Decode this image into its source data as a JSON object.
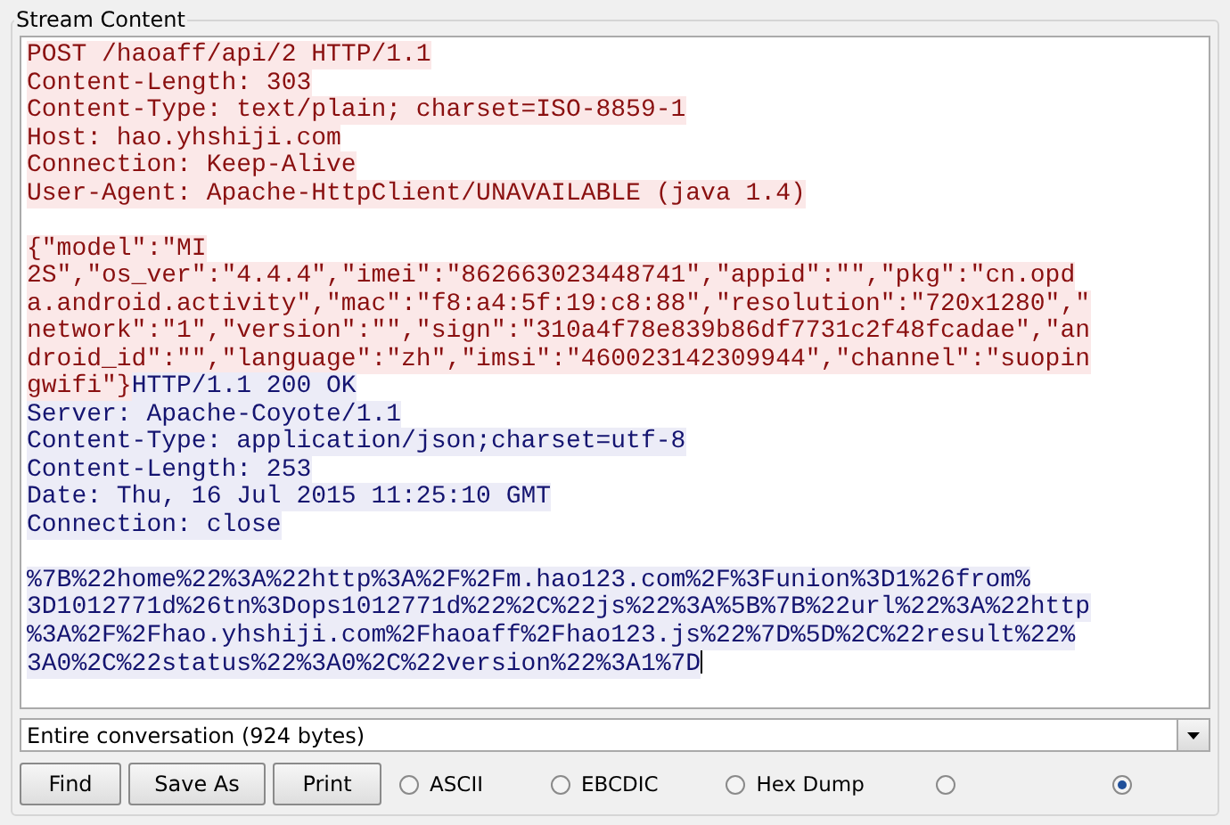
{
  "group": {
    "title": "Stream Content"
  },
  "stream": {
    "lines": [
      {
        "segments": [
          {
            "kind": "client",
            "text": "POST /haoaff/api/2 HTTP/1.1"
          }
        ]
      },
      {
        "segments": [
          {
            "kind": "client",
            "text": "Content-Length: 303"
          }
        ]
      },
      {
        "segments": [
          {
            "kind": "client",
            "text": "Content-Type: text/plain; charset=ISO-8859-1"
          }
        ]
      },
      {
        "segments": [
          {
            "kind": "client",
            "text": "Host: hao.yhshiji.com"
          }
        ]
      },
      {
        "segments": [
          {
            "kind": "client",
            "text": "Connection: Keep-Alive"
          }
        ]
      },
      {
        "segments": [
          {
            "kind": "client",
            "text": "User-Agent: Apache-HttpClient/UNAVAILABLE (java 1.4)"
          }
        ]
      },
      {
        "gap_before": true,
        "segments": [
          {
            "kind": "client",
            "text": "{\"model\":\"MI"
          }
        ]
      },
      {
        "segments": [
          {
            "kind": "client",
            "text": "2S\",\"os_ver\":\"4.4.4\",\"imei\":\"862663023448741\",\"appid\":\"\",\"pkg\":\"cn.opd"
          }
        ]
      },
      {
        "segments": [
          {
            "kind": "client",
            "text": "a.android.activity\",\"mac\":\"f8:a4:5f:19:c8:88\",\"resolution\":\"720x1280\",\""
          }
        ]
      },
      {
        "segments": [
          {
            "kind": "client",
            "text": "network\":\"1\",\"version\":\"\",\"sign\":\"310a4f78e839b86df7731c2f48fcadae\",\"an"
          }
        ]
      },
      {
        "segments": [
          {
            "kind": "client",
            "text": "droid_id\":\"\",\"language\":\"zh\",\"imsi\":\"460023142309944\",\"channel\":\"suopin"
          }
        ]
      },
      {
        "segments": [
          {
            "kind": "client",
            "text": "gwifi\"}"
          },
          {
            "kind": "server",
            "text": "HTTP/1.1 200 OK"
          }
        ]
      },
      {
        "segments": [
          {
            "kind": "server",
            "text": "Server: Apache-Coyote/1.1"
          }
        ]
      },
      {
        "segments": [
          {
            "kind": "server",
            "text": "Content-Type: application/json;charset=utf-8"
          }
        ]
      },
      {
        "segments": [
          {
            "kind": "server",
            "text": "Content-Length: 253"
          }
        ]
      },
      {
        "segments": [
          {
            "kind": "server",
            "text": "Date: Thu, 16 Jul 2015 11:25:10 GMT"
          }
        ]
      },
      {
        "segments": [
          {
            "kind": "server",
            "text": "Connection: close"
          }
        ]
      },
      {
        "gap_before": true,
        "segments": [
          {
            "kind": "server",
            "text": "%7B%22home%22%3A%22http%3A%2F%2Fm.hao123.com%2F%3Funion%3D1%26from%"
          }
        ]
      },
      {
        "segments": [
          {
            "kind": "server",
            "text": "3D1012771d%26tn%3Dops1012771d%22%2C%22js%22%3A%5B%7B%22url%22%3A%22http"
          }
        ]
      },
      {
        "segments": [
          {
            "kind": "server",
            "text": "%3A%2F%2Fhao.yhshiji.com%2Fhaoaff%2Fhao123.js%22%7D%5D%2C%22result%22%"
          }
        ]
      },
      {
        "caret": true,
        "segments": [
          {
            "kind": "server",
            "text": "3A0%2C%22status%22%3A0%2C%22version%22%3A1%7D"
          }
        ]
      }
    ]
  },
  "conversation_select": {
    "value": "Entire conversation (924 bytes)"
  },
  "buttons": [
    {
      "label": "Find"
    },
    {
      "label": "Save As"
    },
    {
      "label": "Print"
    }
  ],
  "formats": [
    {
      "label": "ASCII",
      "selected": false
    },
    {
      "label": "EBCDIC",
      "selected": false
    },
    {
      "label": "Hex Dump",
      "selected": false
    },
    {
      "selected": false
    },
    {
      "selected": true
    }
  ]
}
